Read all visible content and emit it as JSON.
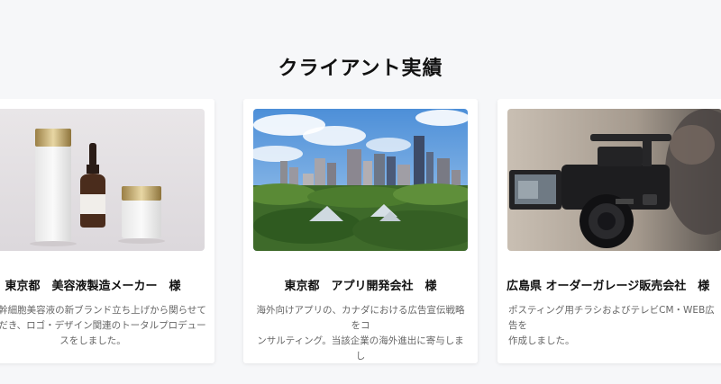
{
  "section": {
    "title": "クライアント実績"
  },
  "cards": [
    {
      "image_icon": "cosmetic-bottles-photo",
      "title": "東京都　美容液製造メーカー　様",
      "description_lines": [
        "ヒト幹細胞美容液の新ブランド立ち上げから関らせて",
        "いただき、ロゴ・デザイン関連のトータルプロデュー",
        "スをしました。"
      ]
    },
    {
      "image_icon": "city-skyline-photo",
      "title": "東京都　アプリ開発会社　様",
      "description_lines": [
        "海外向けアプリの、カナダにおける広告宣伝戦略をコ",
        "ンサルティング。当該企業の海外進出に寄与しまし",
        "た。"
      ]
    },
    {
      "image_icon": "video-camera-photo",
      "title": "広島県 オーダーガレージ販売会社　様",
      "description_lines": [
        "ポスティング用チラシおよびテレビCM・WEB広告を",
        "作成しました。"
      ]
    }
  ]
}
